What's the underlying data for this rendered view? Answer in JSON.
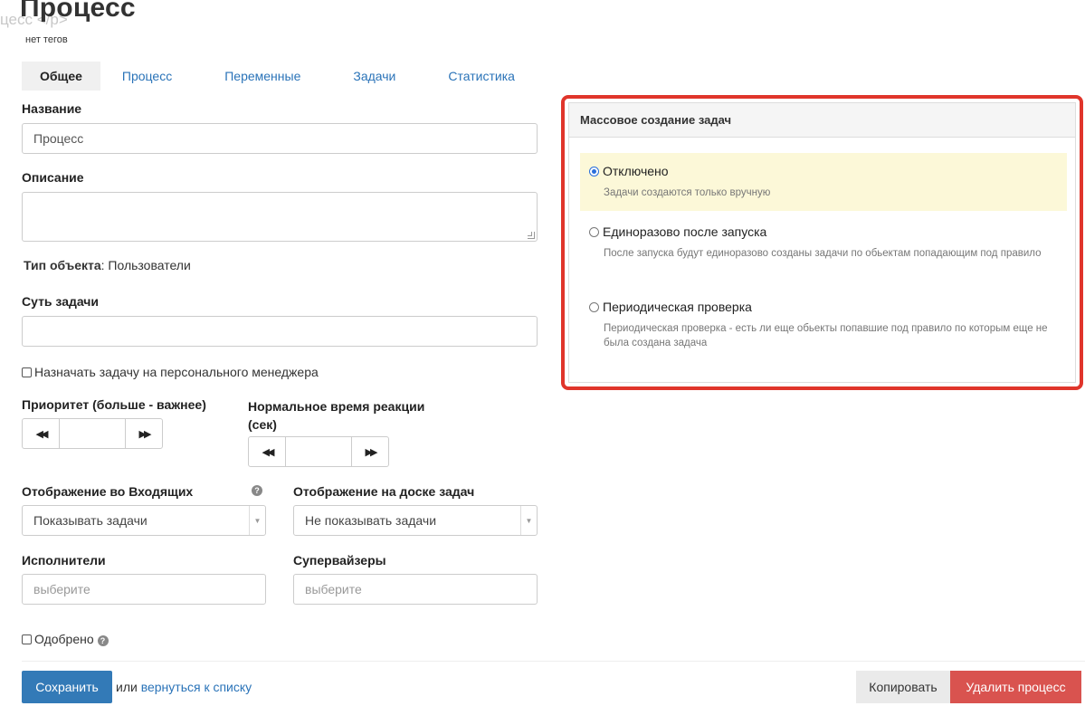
{
  "page": {
    "title": "Процесс",
    "ghost_text": "цесс </p>",
    "tags": "нет тегов"
  },
  "tabs": [
    {
      "label": "Общее",
      "active": true
    },
    {
      "label": "Процесс",
      "active": false
    },
    {
      "label": "Переменные",
      "active": false
    },
    {
      "label": "Задачи",
      "active": false
    },
    {
      "label": "Статистика",
      "active": false
    }
  ],
  "form": {
    "name_label": "Название",
    "name_value": "Процесс",
    "description_label": "Описание",
    "description_value": "",
    "object_type_label": "Тип объекта",
    "object_type_value": ": Пользователи",
    "essence_label": "Суть задачи",
    "essence_value": "",
    "assign_manager_label": "Назначать задачу на персонального менеджера",
    "priority_label": "Приоритет (больше - важнее)",
    "priority_value": "",
    "reaction_label_line1": "Нормальное время реакции",
    "reaction_label_line2": "(сек)",
    "reaction_value": "",
    "inbox_display_label": "Отображение во Входящих",
    "inbox_display_value": "Показывать задачи",
    "board_display_label": "Отображение на доске задач",
    "board_display_value": "Не показывать задачи",
    "executors_label": "Исполнители",
    "executors_placeholder": "выберите",
    "supervisors_label": "Супервайзеры",
    "supervisors_placeholder": "выберите",
    "approved_label": "Одобрено"
  },
  "icons": {
    "help": "question-circle-icon",
    "rewind": "double-left-arrow-icon",
    "forward": "double-right-arrow-icon",
    "caret": "caret-down-icon"
  },
  "footer": {
    "save_label": "Сохранить",
    "or_text": "или",
    "back_link": "вернуться к списку",
    "copy_label": "Копировать",
    "delete_label": "Удалить процесс"
  },
  "mass_creation": {
    "title": "Массовое создание задач",
    "options": [
      {
        "label": "Отключено",
        "description": "Задачи создаются только вручную",
        "selected": true
      },
      {
        "label": "Единоразово после запуска",
        "description": "После запуска будут единоразово созданы задачи по обьектам попадающим под правило",
        "selected": false
      },
      {
        "label": "Периодическая проверка",
        "description": "Периодическая проверка - есть ли еще обьекты попавшие под правило по которым еще не была создана задача",
        "selected": false
      }
    ]
  },
  "colors": {
    "accent": "#337ab7",
    "link": "#2a73b8",
    "danger": "#d9534f",
    "highlight_outline": "#e0352b",
    "selected_option_bg": "#fcf8d8"
  }
}
